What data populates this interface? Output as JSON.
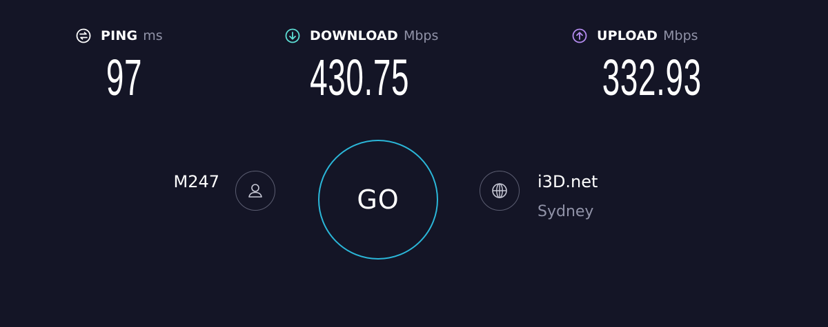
{
  "metrics": {
    "ping": {
      "label": "PING",
      "unit": "ms",
      "value": "97",
      "icon": "ping-icon",
      "color": "#ffffff"
    },
    "download": {
      "label": "DOWNLOAD",
      "unit": "Mbps",
      "value": "430.75",
      "icon": "download-arrow-icon",
      "color": "#5ee0d6"
    },
    "upload": {
      "label": "UPLOAD",
      "unit": "Mbps",
      "value": "332.93",
      "icon": "upload-arrow-icon",
      "color": "#b58cf0"
    }
  },
  "provider": {
    "name": "M247",
    "icon": "user-icon"
  },
  "go_button": {
    "label": "GO",
    "ring_color": "#2bb7d9"
  },
  "server": {
    "name": "i3D.net",
    "location": "Sydney",
    "icon": "globe-icon"
  },
  "colors": {
    "background": "#141526",
    "muted_text": "#9193a8"
  }
}
